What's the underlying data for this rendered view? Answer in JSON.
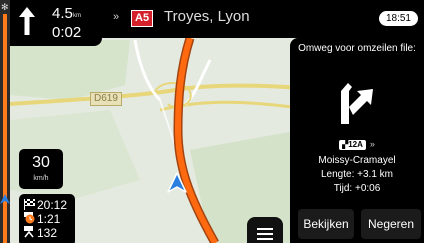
{
  "top_bar": {
    "next_turn_distance": "4.5",
    "next_turn_distance_unit": "km",
    "next_turn_time": "0:02",
    "route_separator": "»",
    "road_number": "A5",
    "destination": "Troyes, Lyon",
    "clock": "18:51"
  },
  "map": {
    "road_label": "D619"
  },
  "speed": {
    "value": "30",
    "unit": "km/h"
  },
  "trip": {
    "arrival_time": "20:12",
    "remaining_time": "1:21",
    "remaining_distance": "132"
  },
  "detour_panel": {
    "title": "Omweg voor omzeilen file:",
    "exit_number": "12A",
    "exit_chevron": "»",
    "place": "Moissy-Cramayel",
    "length": "Lengte: +3.1 km",
    "time": "Tijd: +0:06",
    "view_button": "Bekijken",
    "ignore_button": "Negeren"
  },
  "colors": {
    "route": "#ff6a10",
    "map_background": "#e4eadf",
    "road_shield": "#d4202a",
    "position_arrow": "#2a7fe0"
  },
  "icons": {
    "turn": "straight-arrow-icon",
    "detour": "detour-arrow-icon",
    "menu": "hamburger-menu-icon",
    "position": "navigation-arrow-icon"
  }
}
